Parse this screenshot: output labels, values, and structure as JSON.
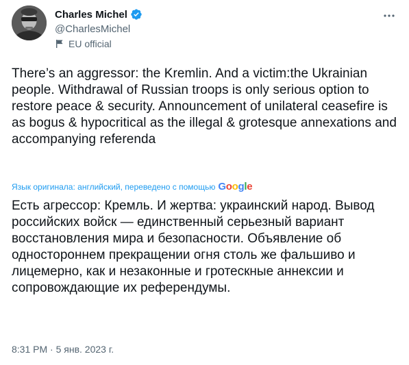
{
  "author": {
    "display_name": "Charles Michel",
    "handle": "@CharlesMichel",
    "affiliation": "EU official",
    "verified": true
  },
  "tweet": {
    "text": "There’s an aggressor: the Kremlin. And a victim:the Ukrainian people. Withdrawal of Russian troops is only serious option to restore peace & security. Announcement of unilateral ceasefire is as bogus & hypocritical as the illegal & grotesque annexations and accompanying referenda",
    "translation_note": "Язык оригинала: английский, переведено с помощью",
    "translation_provider": "Google",
    "translated_text": "Есть агрессор: Кремль. И жертва: украинский народ. Вывод российских войск — единственный серьезный вариант восстановления мира и безопасности. Объявление об одностороннем прекращении огня столь же фальшиво и лицемерно, как и незаконные и гротескные аннексии и сопровождающие их референдумы.",
    "timestamp": "8:31 PM · 5 янв. 2023 г."
  },
  "colors": {
    "text": "#0f1419",
    "secondary": "#536471",
    "accent": "#1d9bf0"
  },
  "icons": {
    "verified": "verified-badge-icon",
    "affiliation": "flag-icon",
    "more": "more-options-icon"
  }
}
